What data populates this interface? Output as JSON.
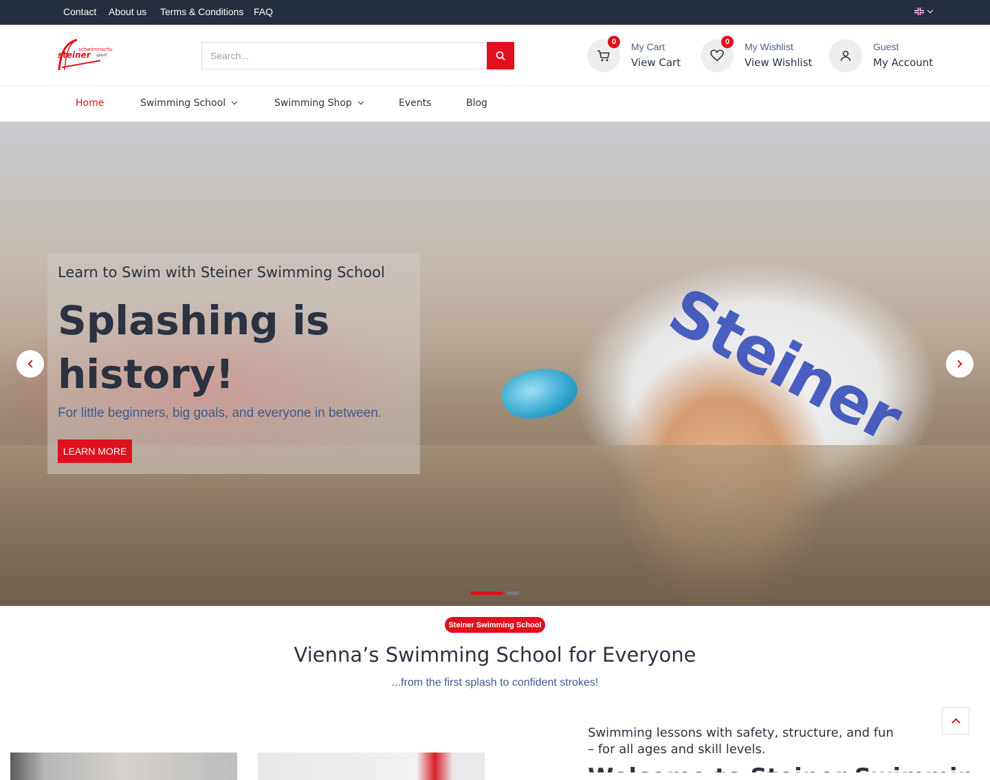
{
  "topbar": {
    "links": [
      "Contact",
      "About us",
      "Terms & Conditions",
      "FAQ"
    ],
    "language_icon": "uk-flag-icon"
  },
  "header": {
    "logo_text": "steiner",
    "logo_sub": "schwimmschule",
    "logo_sub2": "sport",
    "search": {
      "placeholder": "Search...",
      "value": ""
    },
    "cart": {
      "count": "0",
      "label": "My Cart",
      "action": "View Cart"
    },
    "wishlist": {
      "count": "0",
      "label": "My Wishlist",
      "action": "View Wishlist"
    },
    "account": {
      "label": "Guest",
      "action": "My Account"
    }
  },
  "nav": {
    "items": [
      "Home",
      "Swimming School",
      "Swimming Shop",
      "Events",
      "Blog"
    ]
  },
  "hero": {
    "subtitle": "Learn to Swim with Steiner Swimming School",
    "title": "Splashing is history!",
    "description": "For little beginners, big goals, and everyone in between.",
    "button": "LEARN MORE",
    "cap_text": "Steiner",
    "slides_total": 2,
    "active_slide": 1
  },
  "intro": {
    "badge": "Steiner Swimming School",
    "title": "Vienna’s Swimming School for Everyone",
    "subtitle": "...from the first splash to confident strokes!",
    "side_text": "Swimming lessons with safety, structure, and fun – for all ages and skill levels.",
    "side_heading": "Welcome to Steiner Swimming"
  },
  "colors": {
    "accent": "#e0101e",
    "topbar": "#242e3c",
    "text_dark": "#2b3240",
    "text_blue": "#3c5a8c"
  }
}
